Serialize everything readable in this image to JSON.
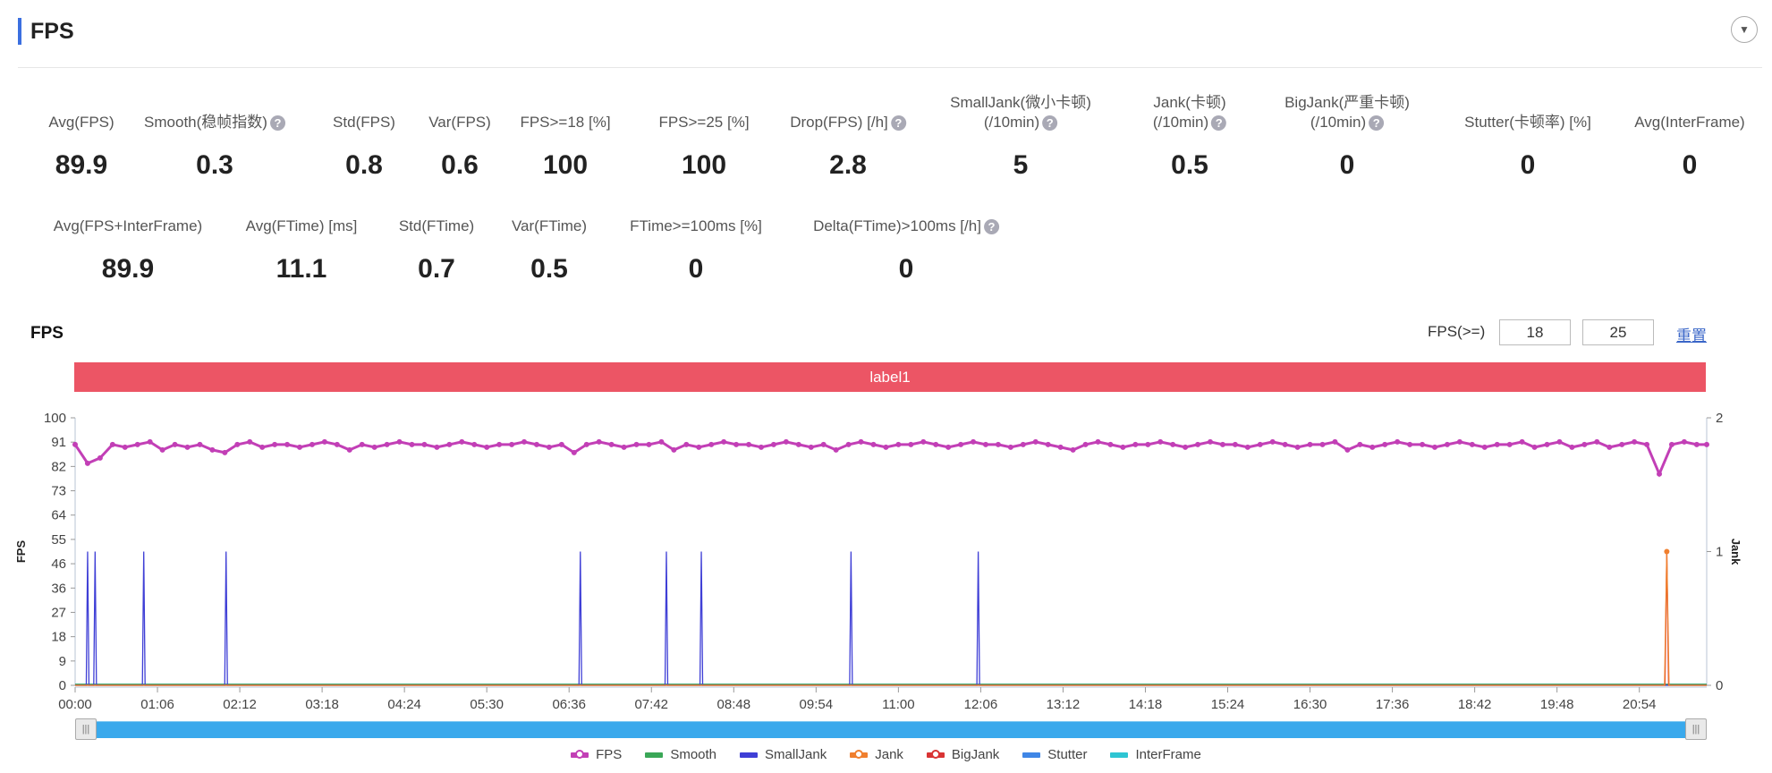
{
  "header": {
    "title": "FPS",
    "collapse_icon": "chevron-down-icon"
  },
  "stats_row1": [
    {
      "label": "Avg(FPS)",
      "value": "89.9"
    },
    {
      "label": "Smooth(稳帧指数)",
      "value": "0.3",
      "help": true
    },
    {
      "label": "Std(FPS)",
      "value": "0.8"
    },
    {
      "label": "Var(FPS)",
      "value": "0.6"
    },
    {
      "label": "FPS>=18 [%]",
      "value": "100"
    },
    {
      "label": "FPS>=25 [%]",
      "value": "100"
    },
    {
      "label": "Drop(FPS) [/h]",
      "value": "2.8",
      "help": true
    },
    {
      "label": "SmallJank(微小卡顿)",
      "label2": "(/10min)",
      "value": "5",
      "help": true
    },
    {
      "label": "Jank(卡顿)",
      "label2": "(/10min)",
      "value": "0.5",
      "help": true
    },
    {
      "label": "BigJank(严重卡顿)",
      "label2": "(/10min)",
      "value": "0",
      "help": true
    },
    {
      "label": "Stutter(卡顿率) [%]",
      "value": "0"
    },
    {
      "label": "Avg(InterFrame)",
      "value": "0"
    }
  ],
  "stats_row2": [
    {
      "label": "Avg(FPS+InterFrame)",
      "value": "89.9"
    },
    {
      "label": "Avg(FTime) [ms]",
      "value": "11.1"
    },
    {
      "label": "Std(FTime)",
      "value": "0.7"
    },
    {
      "label": "Var(FTime)",
      "value": "0.5"
    },
    {
      "label": "FTime>=100ms [%]",
      "value": "0"
    },
    {
      "label": "Delta(FTime)>100ms [/h]",
      "value": "0",
      "help": true
    }
  ],
  "help_glyph": "?",
  "chart_header": {
    "title": "FPS",
    "threshold_label": "FPS(>=)",
    "threshold1": "18",
    "threshold2": "25",
    "reset_label": "重置",
    "label_bar": "label1",
    "label_bar_color": "#ec5565"
  },
  "chart_data": {
    "type": "line",
    "ylabel": "FPS",
    "y2label": "Jank",
    "ylim": [
      0,
      100
    ],
    "y2lim": [
      0,
      2
    ],
    "y_ticks": [
      "0",
      "9",
      "18",
      "27",
      "36",
      "46",
      "55",
      "64",
      "73",
      "82",
      "91",
      "100"
    ],
    "y2_ticks": [
      "0",
      "1",
      "2"
    ],
    "x_ticks": [
      "00:00",
      "01:06",
      "02:12",
      "03:18",
      "04:24",
      "05:30",
      "06:36",
      "07:42",
      "08:48",
      "09:54",
      "11:00",
      "12:06",
      "13:12",
      "14:18",
      "15:24",
      "16:30",
      "17:36",
      "18:42",
      "19:48",
      "20:54"
    ],
    "x_range_seconds": [
      0,
      1308
    ],
    "grid": false,
    "legend_position": "bottom",
    "series": [
      {
        "name": "FPS",
        "color": "#c23fb6",
        "axis": "left",
        "marker": "circle",
        "sample_interval_s": 10,
        "values": [
          90,
          83,
          85,
          90,
          89,
          90,
          91,
          88,
          90,
          89,
          90,
          88,
          87,
          90,
          91,
          89,
          90,
          90,
          89,
          90,
          91,
          90,
          88,
          90,
          89,
          90,
          91,
          90,
          90,
          89,
          90,
          91,
          90,
          89,
          90,
          90,
          91,
          90,
          89,
          90,
          87,
          90,
          91,
          90,
          89,
          90,
          90,
          91,
          88,
          90,
          89,
          90,
          91,
          90,
          90,
          89,
          90,
          91,
          90,
          89,
          90,
          88,
          90,
          91,
          90,
          89,
          90,
          90,
          91,
          90,
          89,
          90,
          91,
          90,
          90,
          89,
          90,
          91,
          90,
          89,
          88,
          90,
          91,
          90,
          89,
          90,
          90,
          91,
          90,
          89,
          90,
          91,
          90,
          90,
          89,
          90,
          91,
          90,
          89,
          90,
          90,
          91,
          88,
          90,
          89,
          90,
          91,
          90,
          90,
          89,
          90,
          91,
          90,
          89,
          90,
          90,
          91,
          89,
          90,
          91,
          89,
          90,
          91,
          89,
          90,
          91,
          90,
          79,
          90,
          91,
          90,
          90
        ]
      },
      {
        "name": "Smooth",
        "color": "#3aa757",
        "axis": "right",
        "values": [
          0
        ]
      },
      {
        "name": "SmallJank",
        "color": "#3f3fd6",
        "axis": "right",
        "spike_times_s": [
          10,
          16,
          55,
          121,
          405,
          474,
          502,
          622,
          724
        ],
        "spike_value": 1
      },
      {
        "name": "Jank",
        "color": "#f07f2e",
        "axis": "right",
        "marker": "circle",
        "spike_times_s": [
          1276
        ],
        "spike_value": 1
      },
      {
        "name": "BigJank",
        "color": "#d93434",
        "axis": "right",
        "marker": "circle",
        "spike_times_s": [
          1276
        ],
        "spike_value": 1
      },
      {
        "name": "Stutter",
        "color": "#3f86e6",
        "axis": "right",
        "values": [
          0
        ]
      },
      {
        "name": "InterFrame",
        "color": "#2ec5d3",
        "axis": "right",
        "values": [
          0
        ]
      }
    ]
  },
  "slider": {
    "start_handle_icon": "grip-icon",
    "end_handle_icon": "grip-icon",
    "range_percent": [
      0,
      100
    ]
  }
}
